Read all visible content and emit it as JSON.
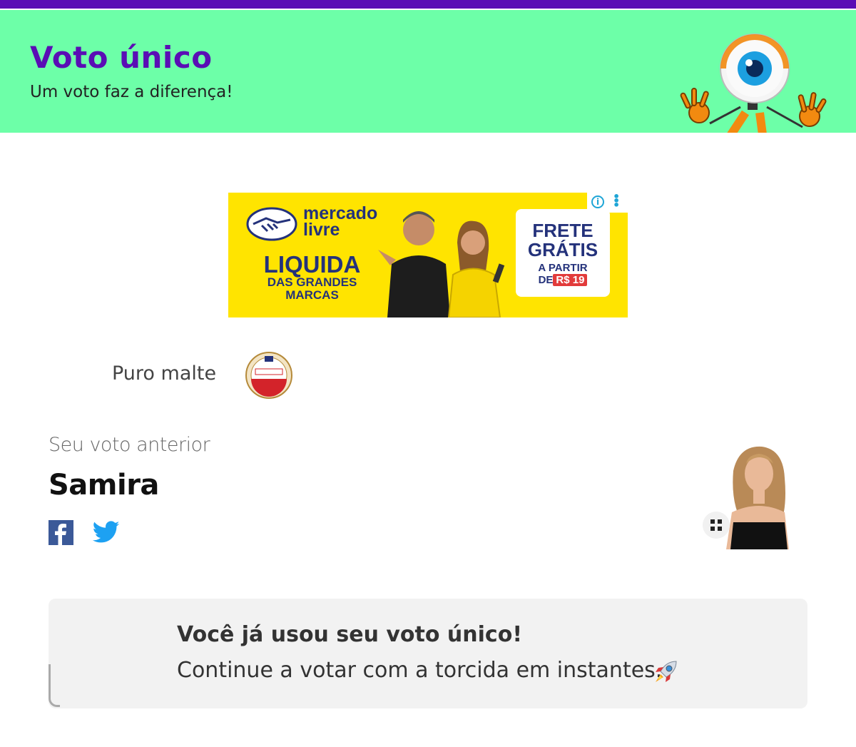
{
  "header": {
    "title": "Voto único",
    "subtitle": "Um voto faz a diferença!",
    "colors": {
      "bar": "#5a0db5",
      "background": "#6dffa8",
      "title": "#5a0db5"
    }
  },
  "ad": {
    "brand_line1": "mercado",
    "brand_line2": "livre",
    "headline_big": "LIQUIDA",
    "headline_small1": "DAS GRANDES",
    "headline_small2": "MARCAS",
    "badge_line1": "FRETE",
    "badge_line2": "GRÁTIS",
    "badge_line3": "A PARTIR",
    "badge_line4": "DE",
    "badge_price": "R$ 19",
    "info_icon": "info-icon",
    "menu_icon": "kebab-menu-icon",
    "background": "#ffe400"
  },
  "sponsor": {
    "label": "Puro malte",
    "logo": "amstel-logo"
  },
  "previous_vote": {
    "label": "Seu voto anterior",
    "name": "Samira",
    "share_icons": [
      "facebook-icon",
      "twitter-icon"
    ],
    "expand_icon": "expand-icon"
  },
  "notice": {
    "title": "Você já usou seu voto único!",
    "text": "Continue a votar com a torcida em instantes.",
    "emoji_icon": "rocket-icon"
  }
}
